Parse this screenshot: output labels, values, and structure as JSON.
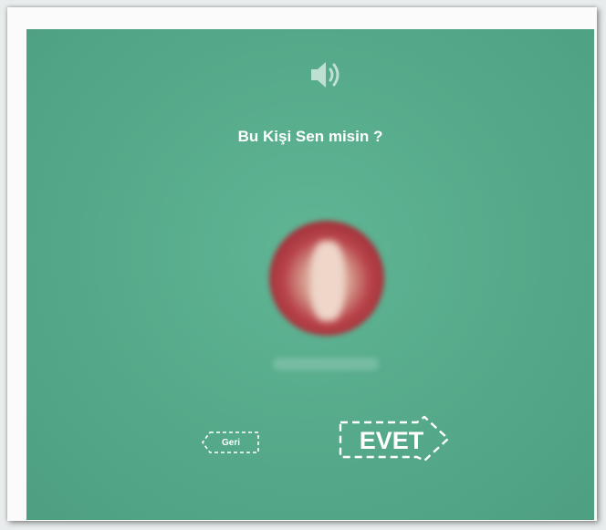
{
  "screen": {
    "question": "Bu Kişi Sen misin ?",
    "profile_name": "",
    "speaker_icon": "speaker-volume-icon"
  },
  "buttons": {
    "back_label": "Geri",
    "confirm_label": "EVET"
  },
  "colors": {
    "panel_green": "#56ab8b",
    "avatar_red": "#b8434a",
    "text": "#ffffff",
    "frame": "#fbfbfb"
  }
}
